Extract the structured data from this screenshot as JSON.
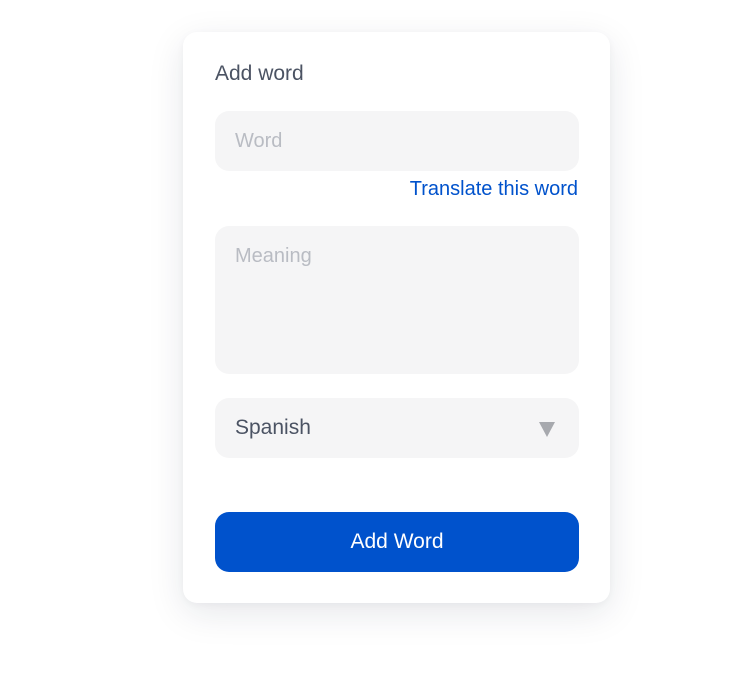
{
  "form": {
    "title": "Add word",
    "word_field": {
      "value": "",
      "placeholder": "Word"
    },
    "translate_link": "Translate this word",
    "meaning_field": {
      "value": "",
      "placeholder": "Meaning"
    },
    "language_select": {
      "selected": "Spanish",
      "icon": "triangle-down-icon"
    },
    "submit_label": "Add Word"
  },
  "colors": {
    "accent": "#0052cc",
    "field_background": "#f5f5f6",
    "text": "#4b5363",
    "placeholder": "#b9bcc3",
    "chevron": "#a7a9ae"
  }
}
